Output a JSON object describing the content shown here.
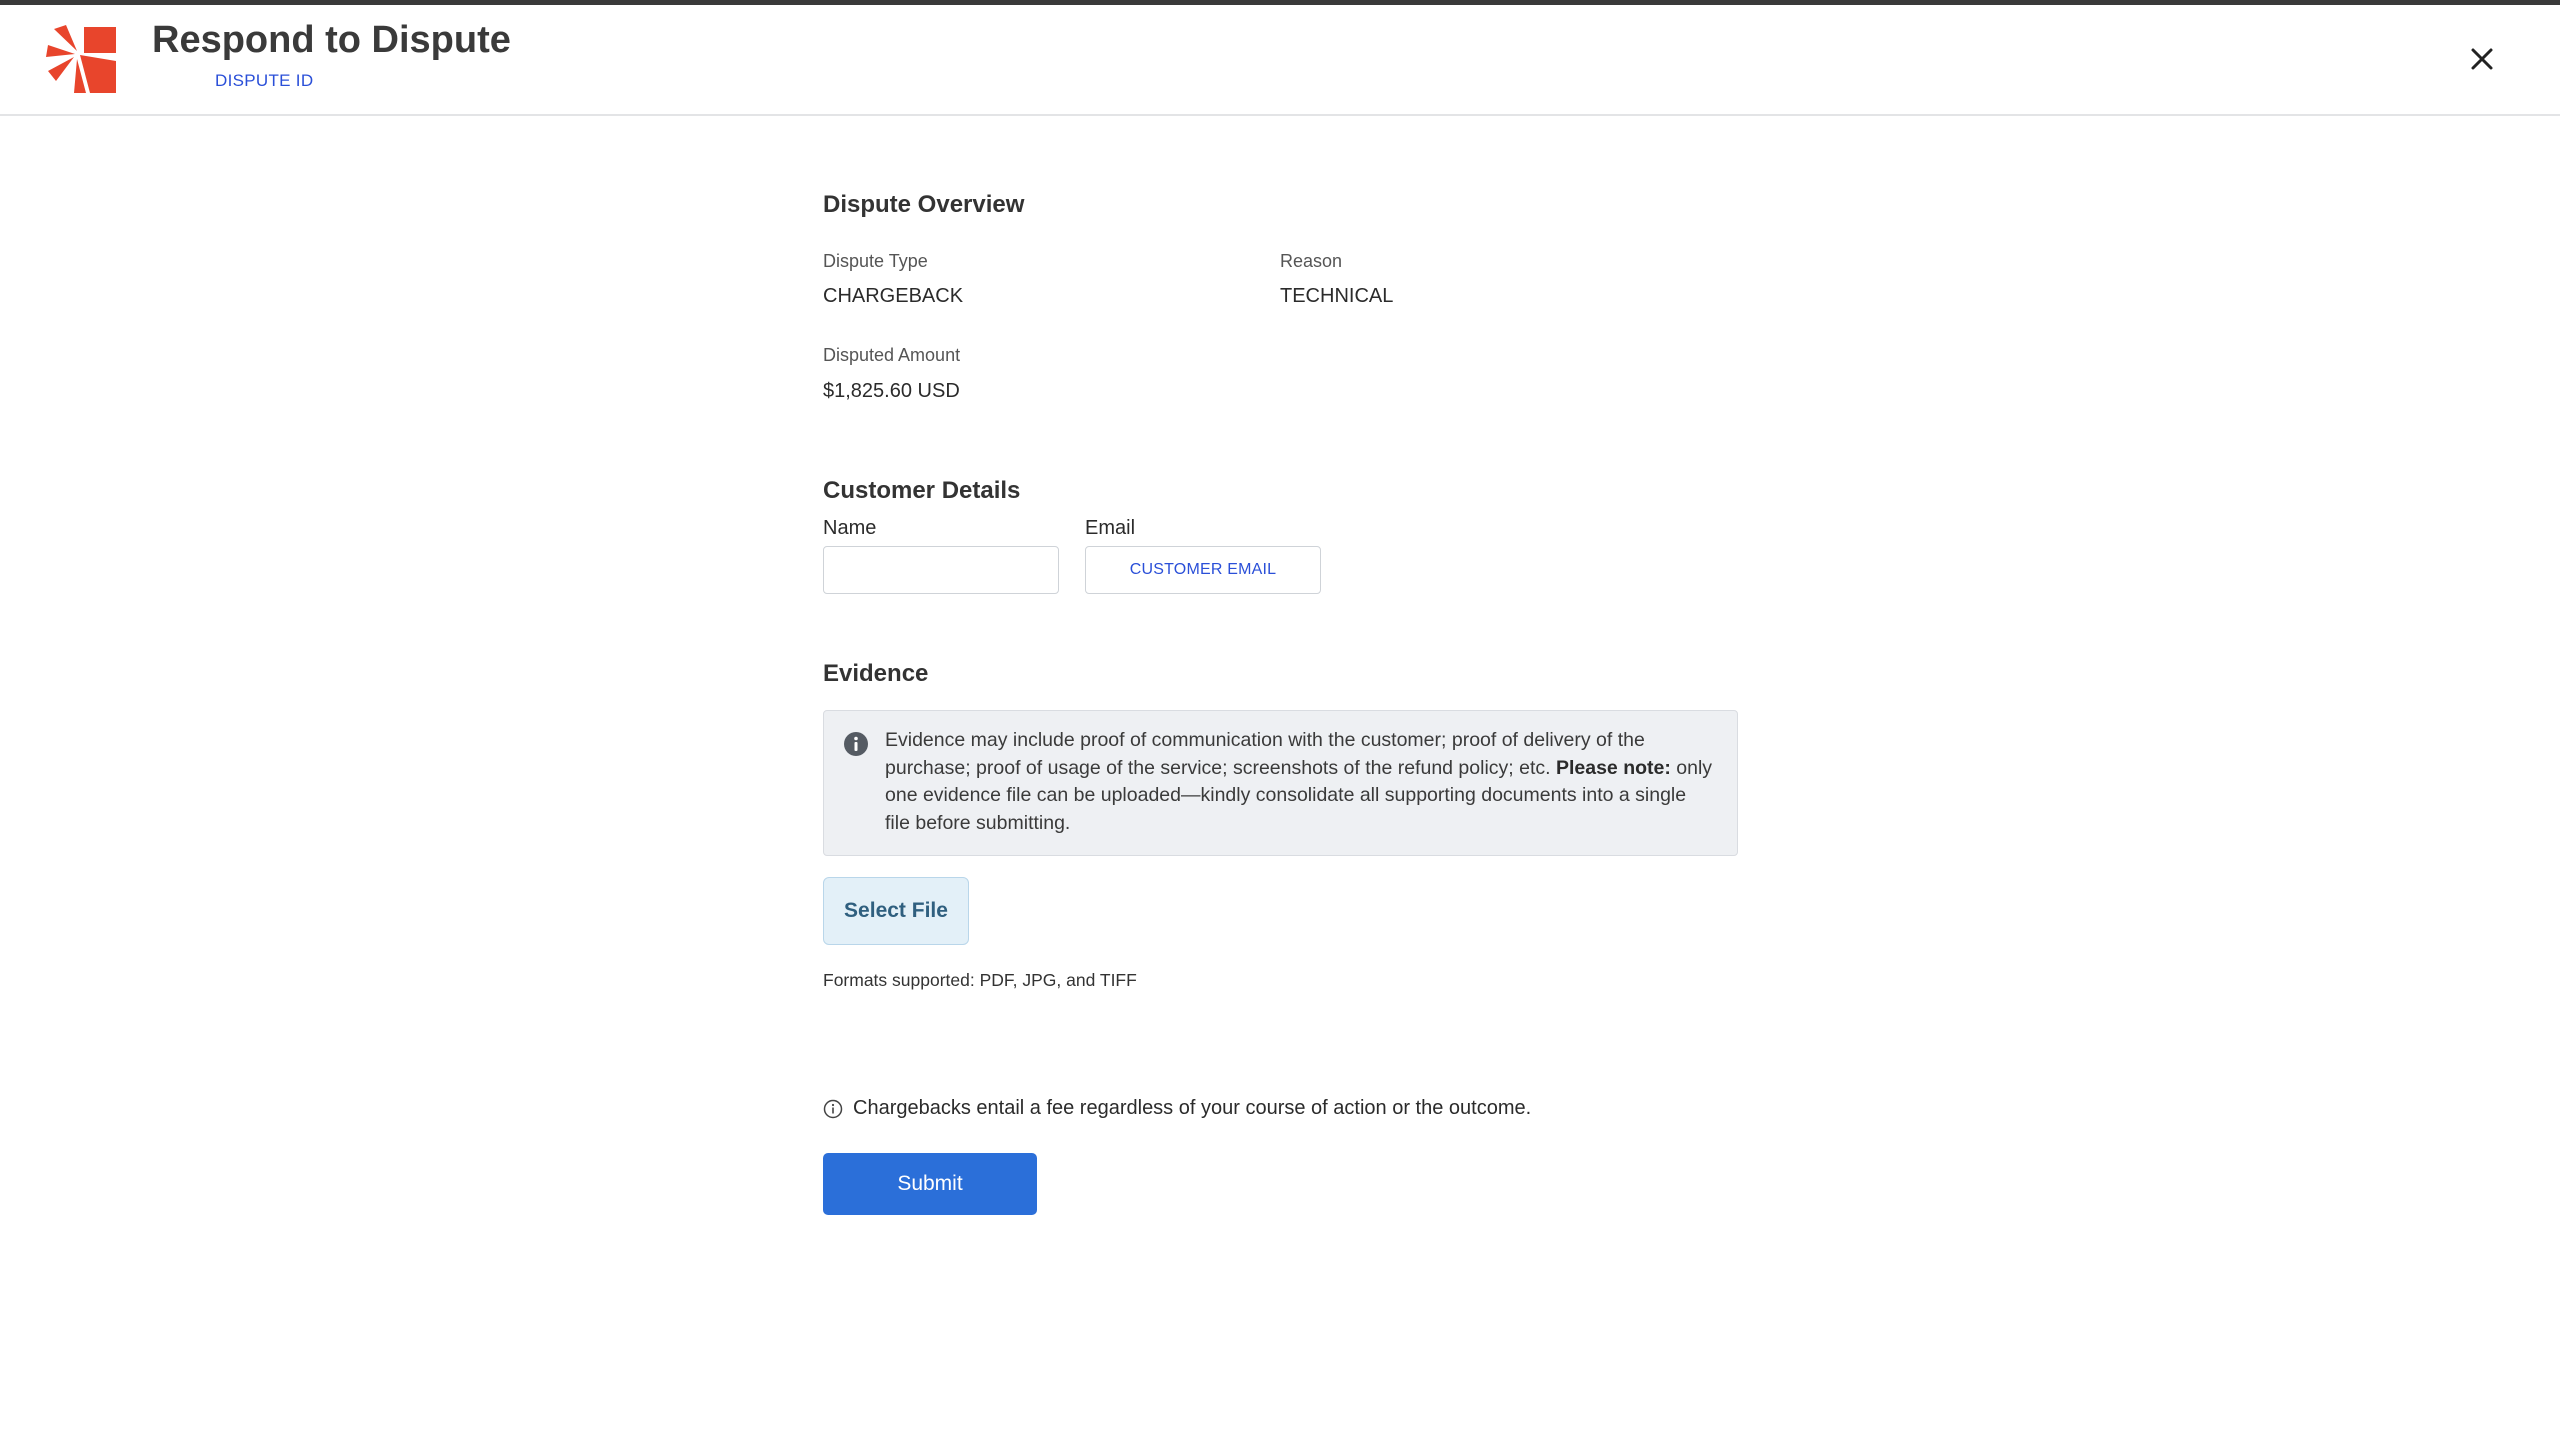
{
  "header": {
    "title": "Respond to Dispute",
    "subtitle": "DISPUTE ID",
    "close_icon": "close-icon",
    "brand_color": "#e8452c"
  },
  "overview": {
    "section_title": "Dispute Overview",
    "dispute_type_label": "Dispute Type",
    "dispute_type_value": "CHARGEBACK",
    "reason_label": "Reason",
    "reason_value": "TECHNICAL",
    "amount_label": "Disputed Amount",
    "amount_value": "$1,825.60 USD"
  },
  "customer": {
    "section_title": "Customer Details",
    "name_label": "Name",
    "name_value": "",
    "email_label": "Email",
    "email_value": "CUSTOMER EMAIL"
  },
  "evidence": {
    "section_title": "Evidence",
    "info_text": "Evidence may include proof of communication with the customer; proof of delivery of the purchase; proof of usage of the service; screenshots of the refund policy; etc.",
    "note_label": "Please note:",
    "note_text": " only one evidence file can be uploaded—kindly consolidate all supporting documents into a single file before submitting.",
    "select_file_label": "Select File",
    "formats_text": "Formats supported: PDF, JPG, and TIFF"
  },
  "footer": {
    "fee_note": "Chargebacks entail a fee regardless of your course of action or the outcome.",
    "submit_label": "Submit",
    "accent_color": "#2b6fd9"
  }
}
